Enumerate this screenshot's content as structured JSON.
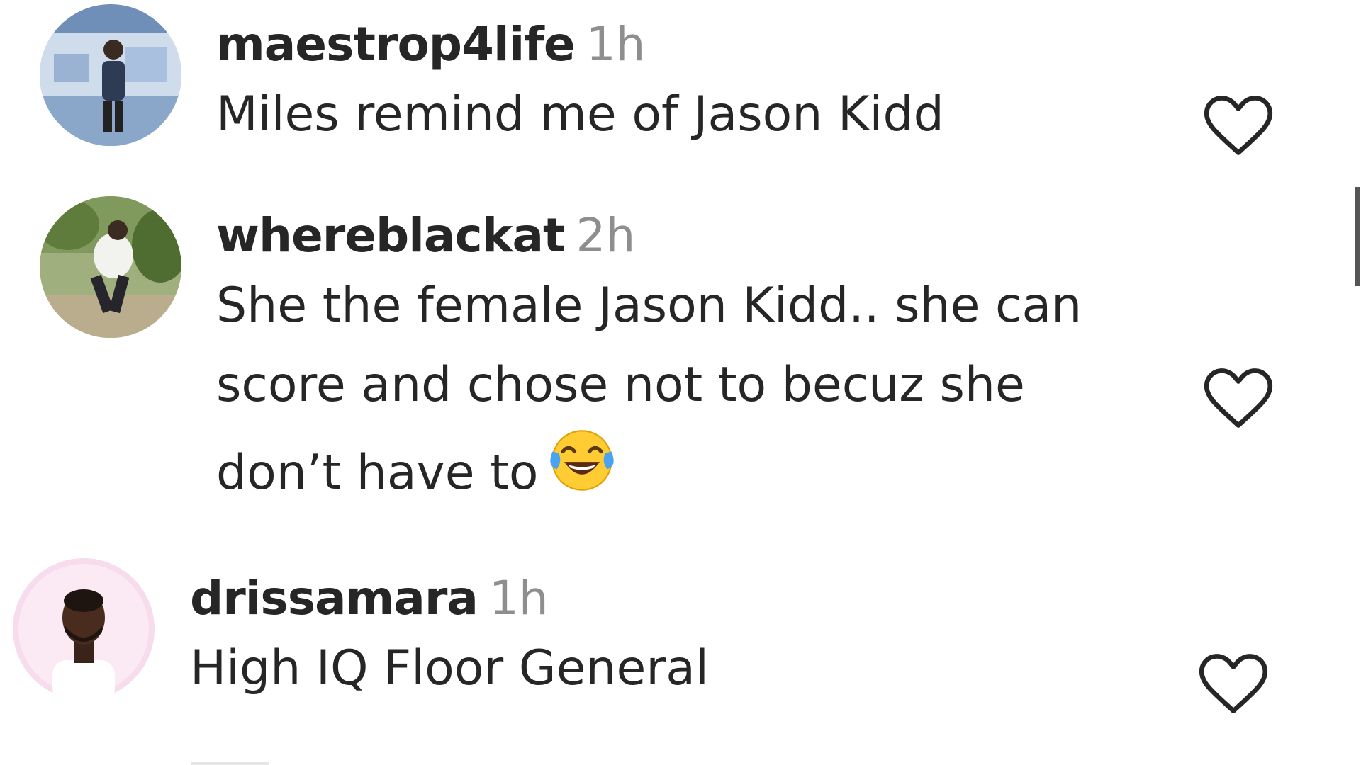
{
  "comments": [
    {
      "username": "maestrop4life",
      "time": "1h",
      "text": "Miles remind me of Jason Kidd",
      "avatar_icon": "user-avatar-photo"
    },
    {
      "username": "whereblackat",
      "time": "2h",
      "text": "She the female Jason Kidd.. she can score and chose not to becuz she don’t have to",
      "emoji": "😂",
      "emoji_icon": "tears-of-joy-emoji",
      "avatar_icon": "user-avatar-photo"
    },
    {
      "username": "drissamara",
      "time": "1h",
      "text": "High IQ Floor General",
      "avatar_icon": "user-avatar-photo"
    }
  ],
  "icons": {
    "like": "heart-outline-icon"
  },
  "colors": {
    "text": "#262626",
    "muted": "#8e8e8e",
    "background": "#ffffff"
  }
}
